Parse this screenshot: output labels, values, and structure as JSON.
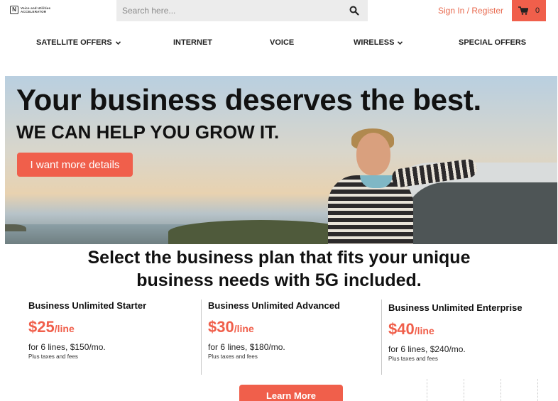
{
  "header": {
    "logo_lines": [
      "Voice and Utilities",
      "ACCELERATOR"
    ],
    "logo_icon": "brand-logo-icon",
    "search_placeholder": "Search here...",
    "search_icon": "search-icon",
    "signin_label": "Sign In / Register",
    "cart_icon": "cart-icon",
    "cart_count": "0"
  },
  "nav": {
    "items": [
      {
        "label": "SATELLITE OFFERS",
        "dropdown": true
      },
      {
        "label": "INTERNET",
        "dropdown": false
      },
      {
        "label": "VOICE",
        "dropdown": false
      },
      {
        "label": "WIRELESS",
        "dropdown": true
      },
      {
        "label": "SPECIAL OFFERS",
        "dropdown": false
      }
    ]
  },
  "hero": {
    "headline": "Your business deserves the best.",
    "subheadline": "WE CAN HELP YOU GROW IT.",
    "cta_label": "I want more details"
  },
  "plans": {
    "title_line1": "Select the business plan that fits your unique",
    "title_line2": "business needs with 5G included.",
    "items": [
      {
        "name": "Business Unlimited Starter",
        "price": "$25",
        "per": "/line",
        "lines": "for 6 lines, $150/mo.",
        "tax": "Plus taxes and fees"
      },
      {
        "name": "Business Unlimited Advanced",
        "price": "$30",
        "per": "/line",
        "lines": "for 6 lines, $180/mo.",
        "tax": "Plus taxes and fees"
      },
      {
        "name": "Business Unlimited Enterprise",
        "price": "$40",
        "per": "/line",
        "lines": "for 6 lines, $240/mo.",
        "tax": "Plus taxes and fees"
      }
    ],
    "learn_more_label": "Learn More"
  },
  "colors": {
    "accent": "#f05f4b",
    "signin": "#e86a4f",
    "search_bg": "#ececec"
  }
}
